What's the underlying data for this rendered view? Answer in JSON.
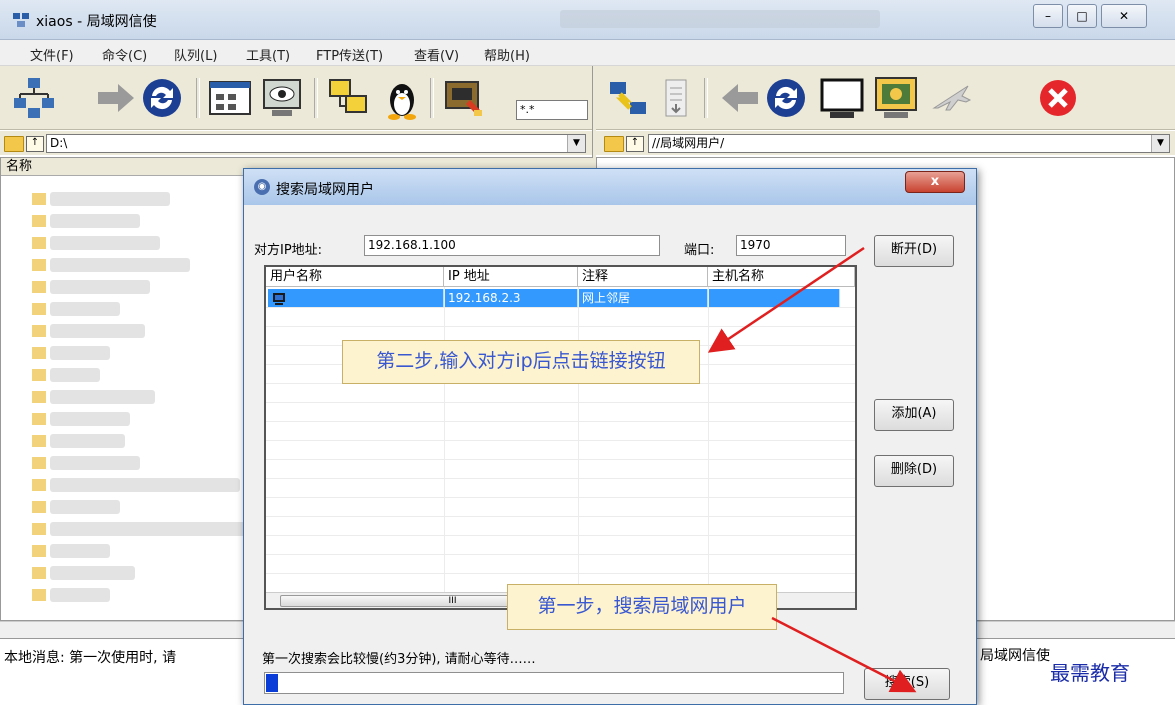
{
  "window": {
    "title": "xiaos - 局域网信使",
    "minimize": "–",
    "maximize": "□",
    "close": "✕"
  },
  "menu": [
    "文件(F)",
    "命令(C)",
    "队列(L)",
    "工具(T)",
    "FTP传送(T)",
    "查看(V)",
    "帮助(H)"
  ],
  "toolbar": {
    "filter_value": "*.*"
  },
  "left_path": "D:\\",
  "right_path": "//局域网用户/",
  "left_pane": {
    "column_name": "名称"
  },
  "status": {
    "local_message": "本地消息: 第一次使用时, 请",
    "right_message": "局域网信使"
  },
  "watermark": "最需教育",
  "dialog": {
    "title": "搜索局域网用户",
    "close_label": "x",
    "ip_label": "对方IP地址:",
    "ip_value": "192.168.1.100",
    "port_label": "端口:",
    "port_value": "1970",
    "buttons": {
      "disconnect": "断开(D)",
      "add": "添加(A)",
      "delete": "删除(D)",
      "search": "搜索(S)"
    },
    "columns": [
      "用户名称",
      "IP 地址",
      "注释",
      "主机名称"
    ],
    "rows": [
      {
        "user": "",
        "ip": "192.168.2.3",
        "note": "网上邻居",
        "host": ""
      }
    ],
    "scroll_thumb": "III",
    "search_message": "第一次搜索会比较慢(约3分钟), 请耐心等待……",
    "progress_percent": 2
  },
  "callouts": {
    "step2": "第二步,输入对方ip后点击链接按钮",
    "step1": "第一步，搜索局域网用户"
  },
  "colors": {
    "selection": "#3399ff",
    "arrow": "#e02020",
    "callout_text": "#3857d0",
    "progress": "#0a3cd8"
  }
}
